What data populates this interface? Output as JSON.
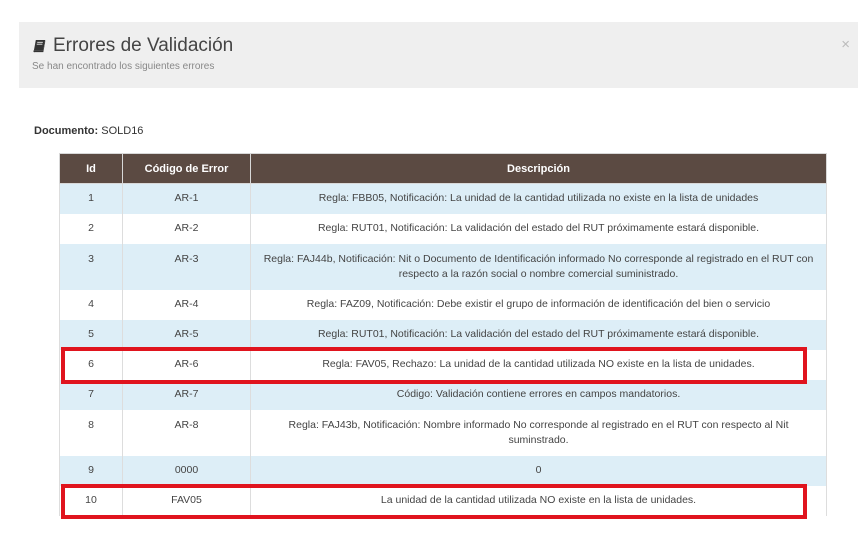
{
  "header": {
    "title": "Errores de Validación",
    "subtitle": "Se han encontrado los siguientes errores",
    "close_label": "×"
  },
  "document": {
    "label": "Documento:",
    "value": "SOLD16"
  },
  "table": {
    "columns": [
      "Id",
      "Código de Error",
      "Descripción"
    ],
    "rows": [
      {
        "id": "1",
        "code": "AR-1",
        "desc": "Regla: FBB05, Notificación: La unidad de la cantidad utilizada no existe en la lista de unidades"
      },
      {
        "id": "2",
        "code": "AR-2",
        "desc": "Regla: RUT01, Notificación: La validación del estado del RUT próximamente estará disponible."
      },
      {
        "id": "3",
        "code": "AR-3",
        "desc": "Regla: FAJ44b, Notificación: Nit o Documento de Identificación informado No corresponde al registrado en el RUT con respecto a la razón social o nombre comercial suministrado."
      },
      {
        "id": "4",
        "code": "AR-4",
        "desc": "Regla: FAZ09, Notificación: Debe existir el grupo de información de identificación del bien o servicio"
      },
      {
        "id": "5",
        "code": "AR-5",
        "desc": "Regla: RUT01, Notificación: La validación del estado del RUT próximamente estará disponible."
      },
      {
        "id": "6",
        "code": "AR-6",
        "desc": "Regla: FAV05, Rechazo: La unidad de la cantidad utilizada NO existe en la lista de unidades."
      },
      {
        "id": "7",
        "code": "AR-7",
        "desc": "Código: Validación contiene errores en campos mandatorios."
      },
      {
        "id": "8",
        "code": "AR-8",
        "desc": "Regla: FAJ43b, Notificación: Nombre informado No corresponde al registrado en el RUT con respecto al Nit suminstrado."
      },
      {
        "id": "9",
        "code": "0000",
        "desc": "0"
      },
      {
        "id": "10",
        "code": "FAV05",
        "desc": "La unidad de la cantidad utilizada NO existe en la lista de unidades."
      }
    ]
  },
  "colors": {
    "header_bg": "#5b4a42",
    "stripe": "#ddeef7",
    "highlight": "#e0141e"
  }
}
